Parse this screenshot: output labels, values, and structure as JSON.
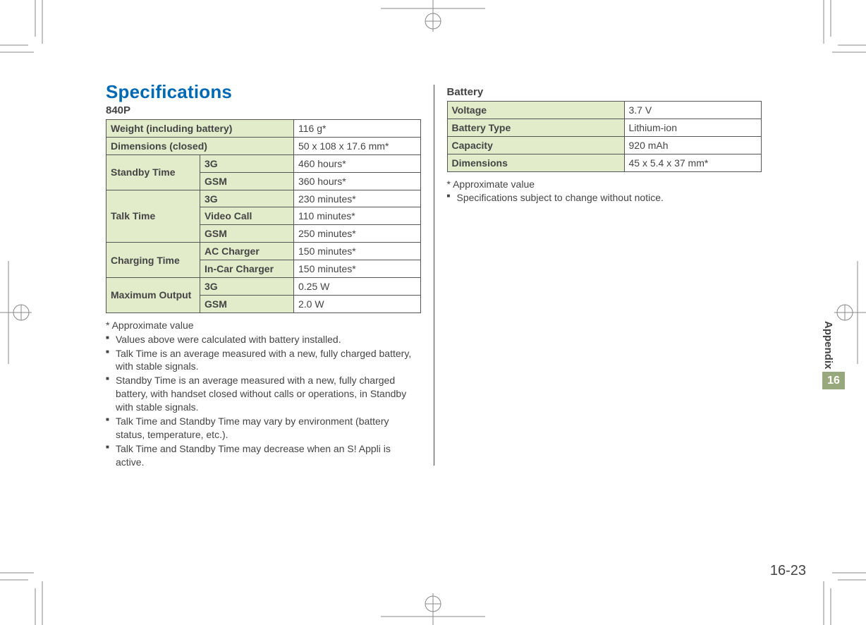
{
  "title": "Specifications",
  "model": "840P",
  "table1": {
    "weight_label": "Weight (including battery)",
    "weight_val": "116 g*",
    "dims_label": "Dimensions (closed)",
    "dims_val": "50 x 108 x 17.6 mm*",
    "standby_label": "Standby Time",
    "standby_rows": [
      {
        "net": "3G",
        "val": "460 hours*"
      },
      {
        "net": "GSM",
        "val": "360 hours*"
      }
    ],
    "talk_label": "Talk Time",
    "talk_rows": [
      {
        "net": "3G",
        "val": "230 minutes*"
      },
      {
        "net": "Video Call",
        "val": "110 minutes*"
      },
      {
        "net": "GSM",
        "val": "250 minutes*"
      }
    ],
    "charge_label": "Charging Time",
    "charge_rows": [
      {
        "net": "AC Charger",
        "val": "150 minutes*"
      },
      {
        "net": "In-Car Charger",
        "val": "150 minutes*"
      }
    ],
    "max_label": "Maximum Output",
    "max_rows": [
      {
        "net": "3G",
        "val": "0.25 W"
      },
      {
        "net": "GSM",
        "val": "2.0 W"
      }
    ]
  },
  "footnote1": "* Approximate value",
  "bullets1": [
    "Values above were calculated with battery installed.",
    "Talk Time is an average measured with a new, fully charged battery, with stable signals.",
    "Standby Time is an average measured with a new, fully charged battery, with handset closed without calls or operations, in Standby with stable signals.",
    "Talk Time and Standby Time may vary by environment (battery status, temperature, etc.).",
    "Talk Time and Standby Time may decrease when an S! Appli is active."
  ],
  "battery_title": "Battery",
  "table2": [
    {
      "label": "Voltage",
      "val": "3.7 V"
    },
    {
      "label": "Battery Type",
      "val": "Lithium-ion"
    },
    {
      "label": "Capacity",
      "val": "920 mAh"
    },
    {
      "label": "Dimensions",
      "val": "45 x 5.4 x 37 mm*"
    }
  ],
  "footnote2": "* Approximate value",
  "bullets2": [
    "Specifications subject to change without notice."
  ],
  "tab_label": "Appendix",
  "tab_num": "16",
  "page_num": "16-23"
}
